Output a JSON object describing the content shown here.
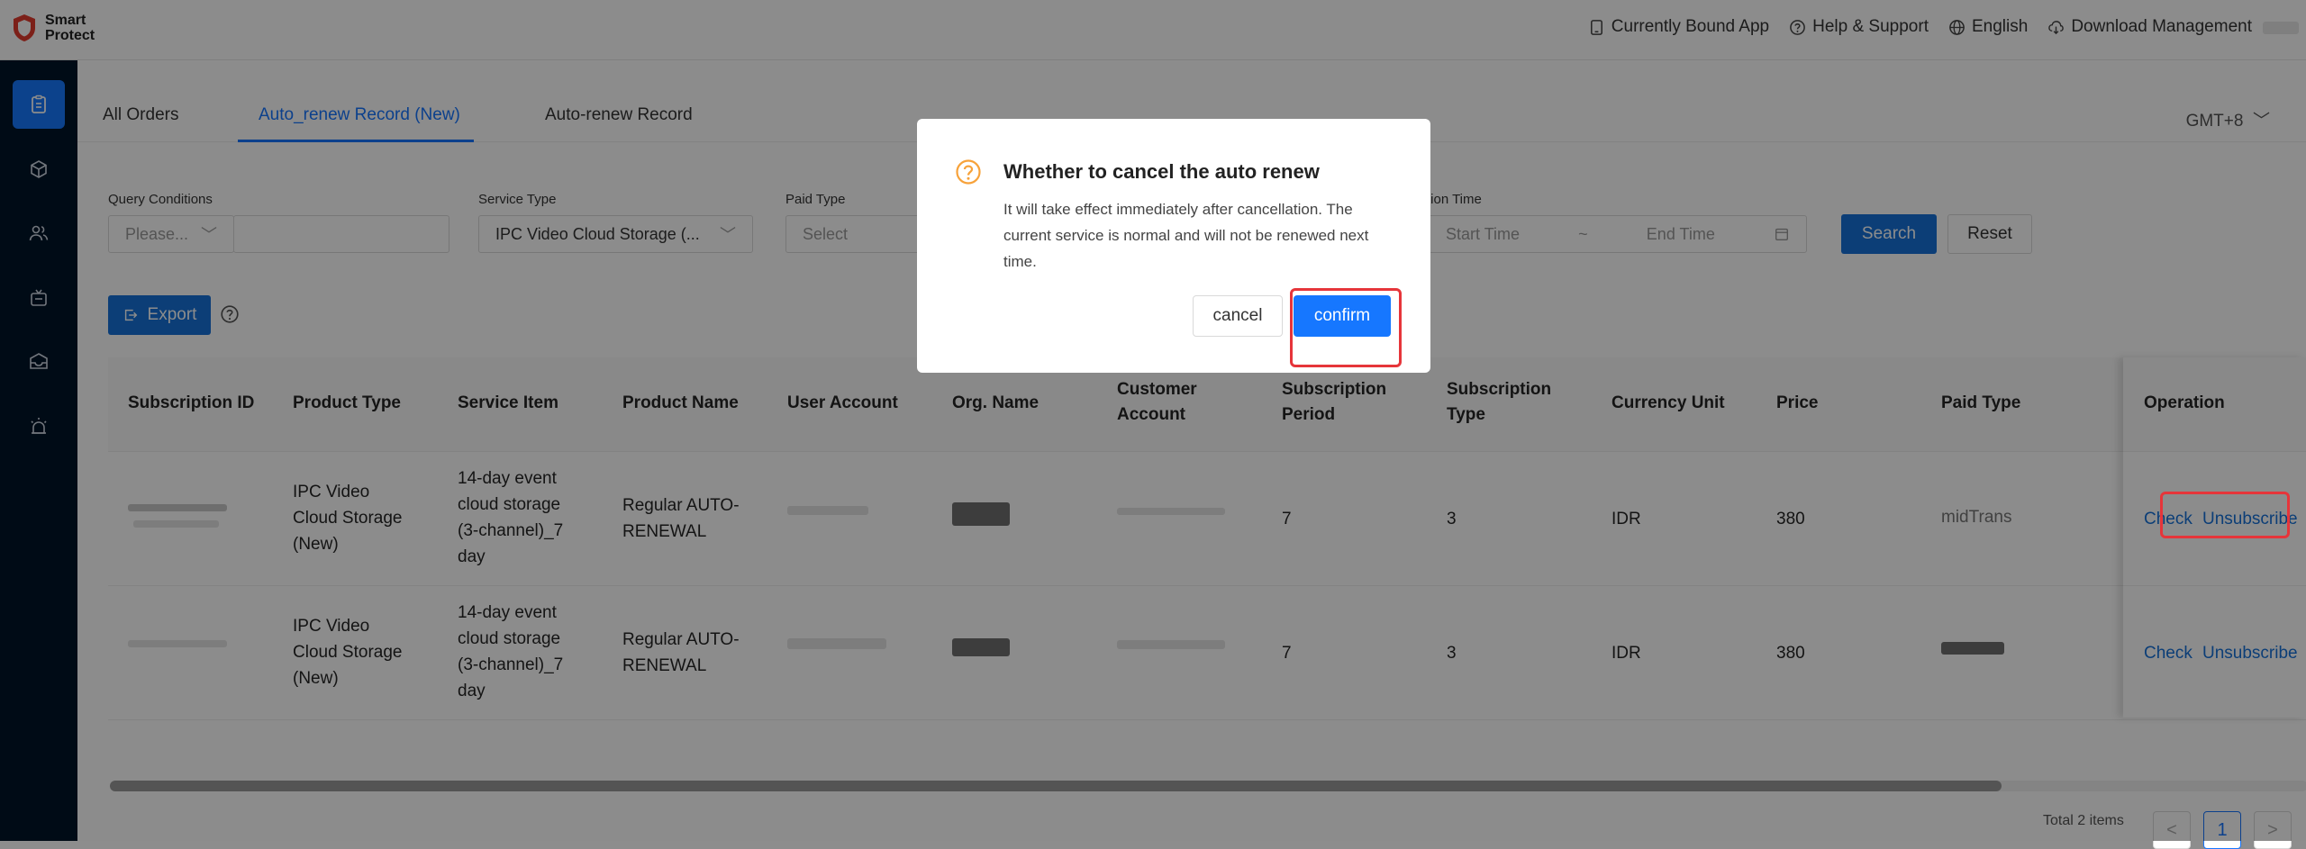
{
  "header": {
    "logo_line1": "Smart",
    "logo_line2": "Protect",
    "nav": [
      {
        "label": "Currently Bound App",
        "icon": "tablet-icon"
      },
      {
        "label": "Help & Support",
        "icon": "question-circle-icon"
      },
      {
        "label": "English",
        "icon": "globe-icon"
      },
      {
        "label": "Download Management",
        "icon": "cloud-download-icon"
      }
    ]
  },
  "sidebar": {
    "items": [
      "orders-icon",
      "cube-icon",
      "users-icon",
      "device-icon",
      "inbox-icon",
      "alarm-icon"
    ],
    "toggle": ">"
  },
  "tabs": {
    "items": [
      "All Orders",
      "Auto_renew Record (New)",
      "Auto-renew Record"
    ],
    "active": 1,
    "timezone": "GMT+8"
  },
  "filters": {
    "query_label": "Query Conditions",
    "query_placeholder": "Please...",
    "service_label": "Service Type",
    "service_value": "IPC Video Cloud Storage (...",
    "paid_label": "Paid Type",
    "paid_placeholder": "Select",
    "time_label": "tion Time",
    "start_placeholder": "Start Time",
    "end_placeholder": "End Time",
    "tilde": "~",
    "search": "Search",
    "reset": "Reset",
    "export": "Export"
  },
  "table": {
    "headers": [
      "Subscription ID",
      "Product Type",
      "Service Item",
      "Product Name",
      "User Account",
      "Org. Name",
      "Customer Account",
      "Subscription Period",
      "Subscription Type",
      "Currency Unit",
      "Price",
      "Paid Type",
      "Operation"
    ],
    "rows": [
      {
        "product_type": "IPC Video Cloud Storage (New)",
        "service_item": "14-day event cloud storage (3-channel)_7 day",
        "product_name": "Regular AUTO-RENEWAL",
        "period": "7",
        "type": "3",
        "currency": "IDR",
        "price": "380",
        "paid_type": "midTrans",
        "check": "Check",
        "unsubscribe": "Unsubscribe"
      },
      {
        "product_type": "IPC Video Cloud Storage (New)",
        "service_item": "14-day event cloud storage (3-channel)_7 day",
        "product_name": "Regular AUTO-RENEWAL",
        "period": "7",
        "type": "3",
        "currency": "IDR",
        "price": "380",
        "paid_type": "",
        "check": "Check",
        "unsubscribe": "Unsubscribe"
      }
    ]
  },
  "pagination": {
    "total": "Total 2 items",
    "current": "1",
    "prev": "<",
    "next": ">"
  },
  "modal": {
    "title": "Whether to cancel the auto renew",
    "body": "It will take effect immediately after cancellation. The current service is normal and will not be renewed next time.",
    "cancel": "cancel",
    "confirm": "confirm"
  },
  "colors": {
    "accent": "#1677ff",
    "highlight": "#e6353a",
    "sidebar": "#001529"
  }
}
